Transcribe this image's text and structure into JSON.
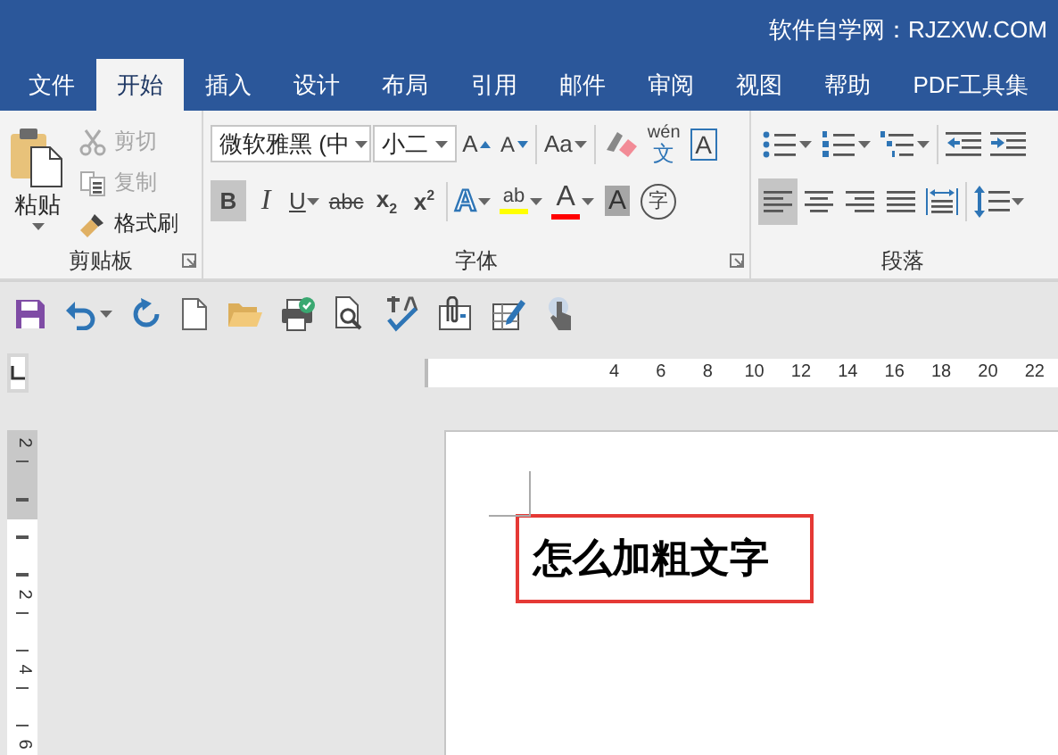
{
  "title_bar": {
    "site": "软件自学网：RJZXW.COM"
  },
  "tabs": [
    {
      "label": "文件",
      "selected": false
    },
    {
      "label": "开始",
      "selected": true
    },
    {
      "label": "插入",
      "selected": false
    },
    {
      "label": "设计",
      "selected": false
    },
    {
      "label": "布局",
      "selected": false
    },
    {
      "label": "引用",
      "selected": false
    },
    {
      "label": "邮件",
      "selected": false
    },
    {
      "label": "审阅",
      "selected": false
    },
    {
      "label": "视图",
      "selected": false
    },
    {
      "label": "帮助",
      "selected": false
    },
    {
      "label": "PDF工具集",
      "selected": false
    }
  ],
  "clipboard": {
    "paste": "粘贴",
    "items": [
      {
        "kind": "cut",
        "label": "剪切",
        "disabled": true
      },
      {
        "kind": "copy",
        "label": "复制",
        "disabled": true
      },
      {
        "kind": "brush",
        "label": "格式刷",
        "disabled": false
      }
    ],
    "group_label": "剪贴板"
  },
  "font": {
    "font_name": "微软雅黑 (中",
    "font_size": "小二",
    "row1": [
      {
        "kind": "grow",
        "label": "A"
      },
      {
        "kind": "shrink",
        "label": "A"
      },
      {
        "kind": "case",
        "label": "Aa"
      },
      {
        "kind": "clear"
      },
      {
        "kind": "phonetic",
        "ruby": "wén",
        "label": "文"
      },
      {
        "kind": "boxed",
        "label": "A"
      }
    ],
    "row2": [
      {
        "kind": "bold",
        "label": "B",
        "selected": true
      },
      {
        "kind": "italic",
        "label": "I",
        "selected": false
      },
      {
        "kind": "underline",
        "label": "U",
        "selected": false
      },
      {
        "kind": "strike",
        "label": "abc",
        "selected": false
      },
      {
        "kind": "subscript",
        "label": "x",
        "script": "2",
        "selected": false
      },
      {
        "kind": "superscript",
        "label": "x",
        "script": "2",
        "selected": false
      },
      {
        "kind": "effect",
        "label": "A"
      },
      {
        "kind": "highlight",
        "label": "ab",
        "color": "#ffff00"
      },
      {
        "kind": "color",
        "label": "A",
        "color": "#ff0000"
      },
      {
        "kind": "shade",
        "label": "A"
      },
      {
        "kind": "enclose",
        "label": "字"
      }
    ],
    "group_label": "字体"
  },
  "paragraph": {
    "alignments": [
      {
        "kind": "left",
        "selected": true
      },
      {
        "kind": "center",
        "selected": false
      },
      {
        "kind": "right",
        "selected": false
      },
      {
        "kind": "justify",
        "selected": false
      },
      {
        "kind": "distributed",
        "selected": false
      }
    ],
    "group_label": "段落"
  },
  "horizontal_ruler": {
    "labels": [
      "4",
      "6",
      "8",
      "10",
      "12",
      "14",
      "16",
      "18",
      "20",
      "22"
    ]
  },
  "vertical_ruler": {
    "labels": [
      "2",
      "2",
      "4",
      "6"
    ]
  },
  "document": {
    "text": "怎么加粗文字"
  }
}
